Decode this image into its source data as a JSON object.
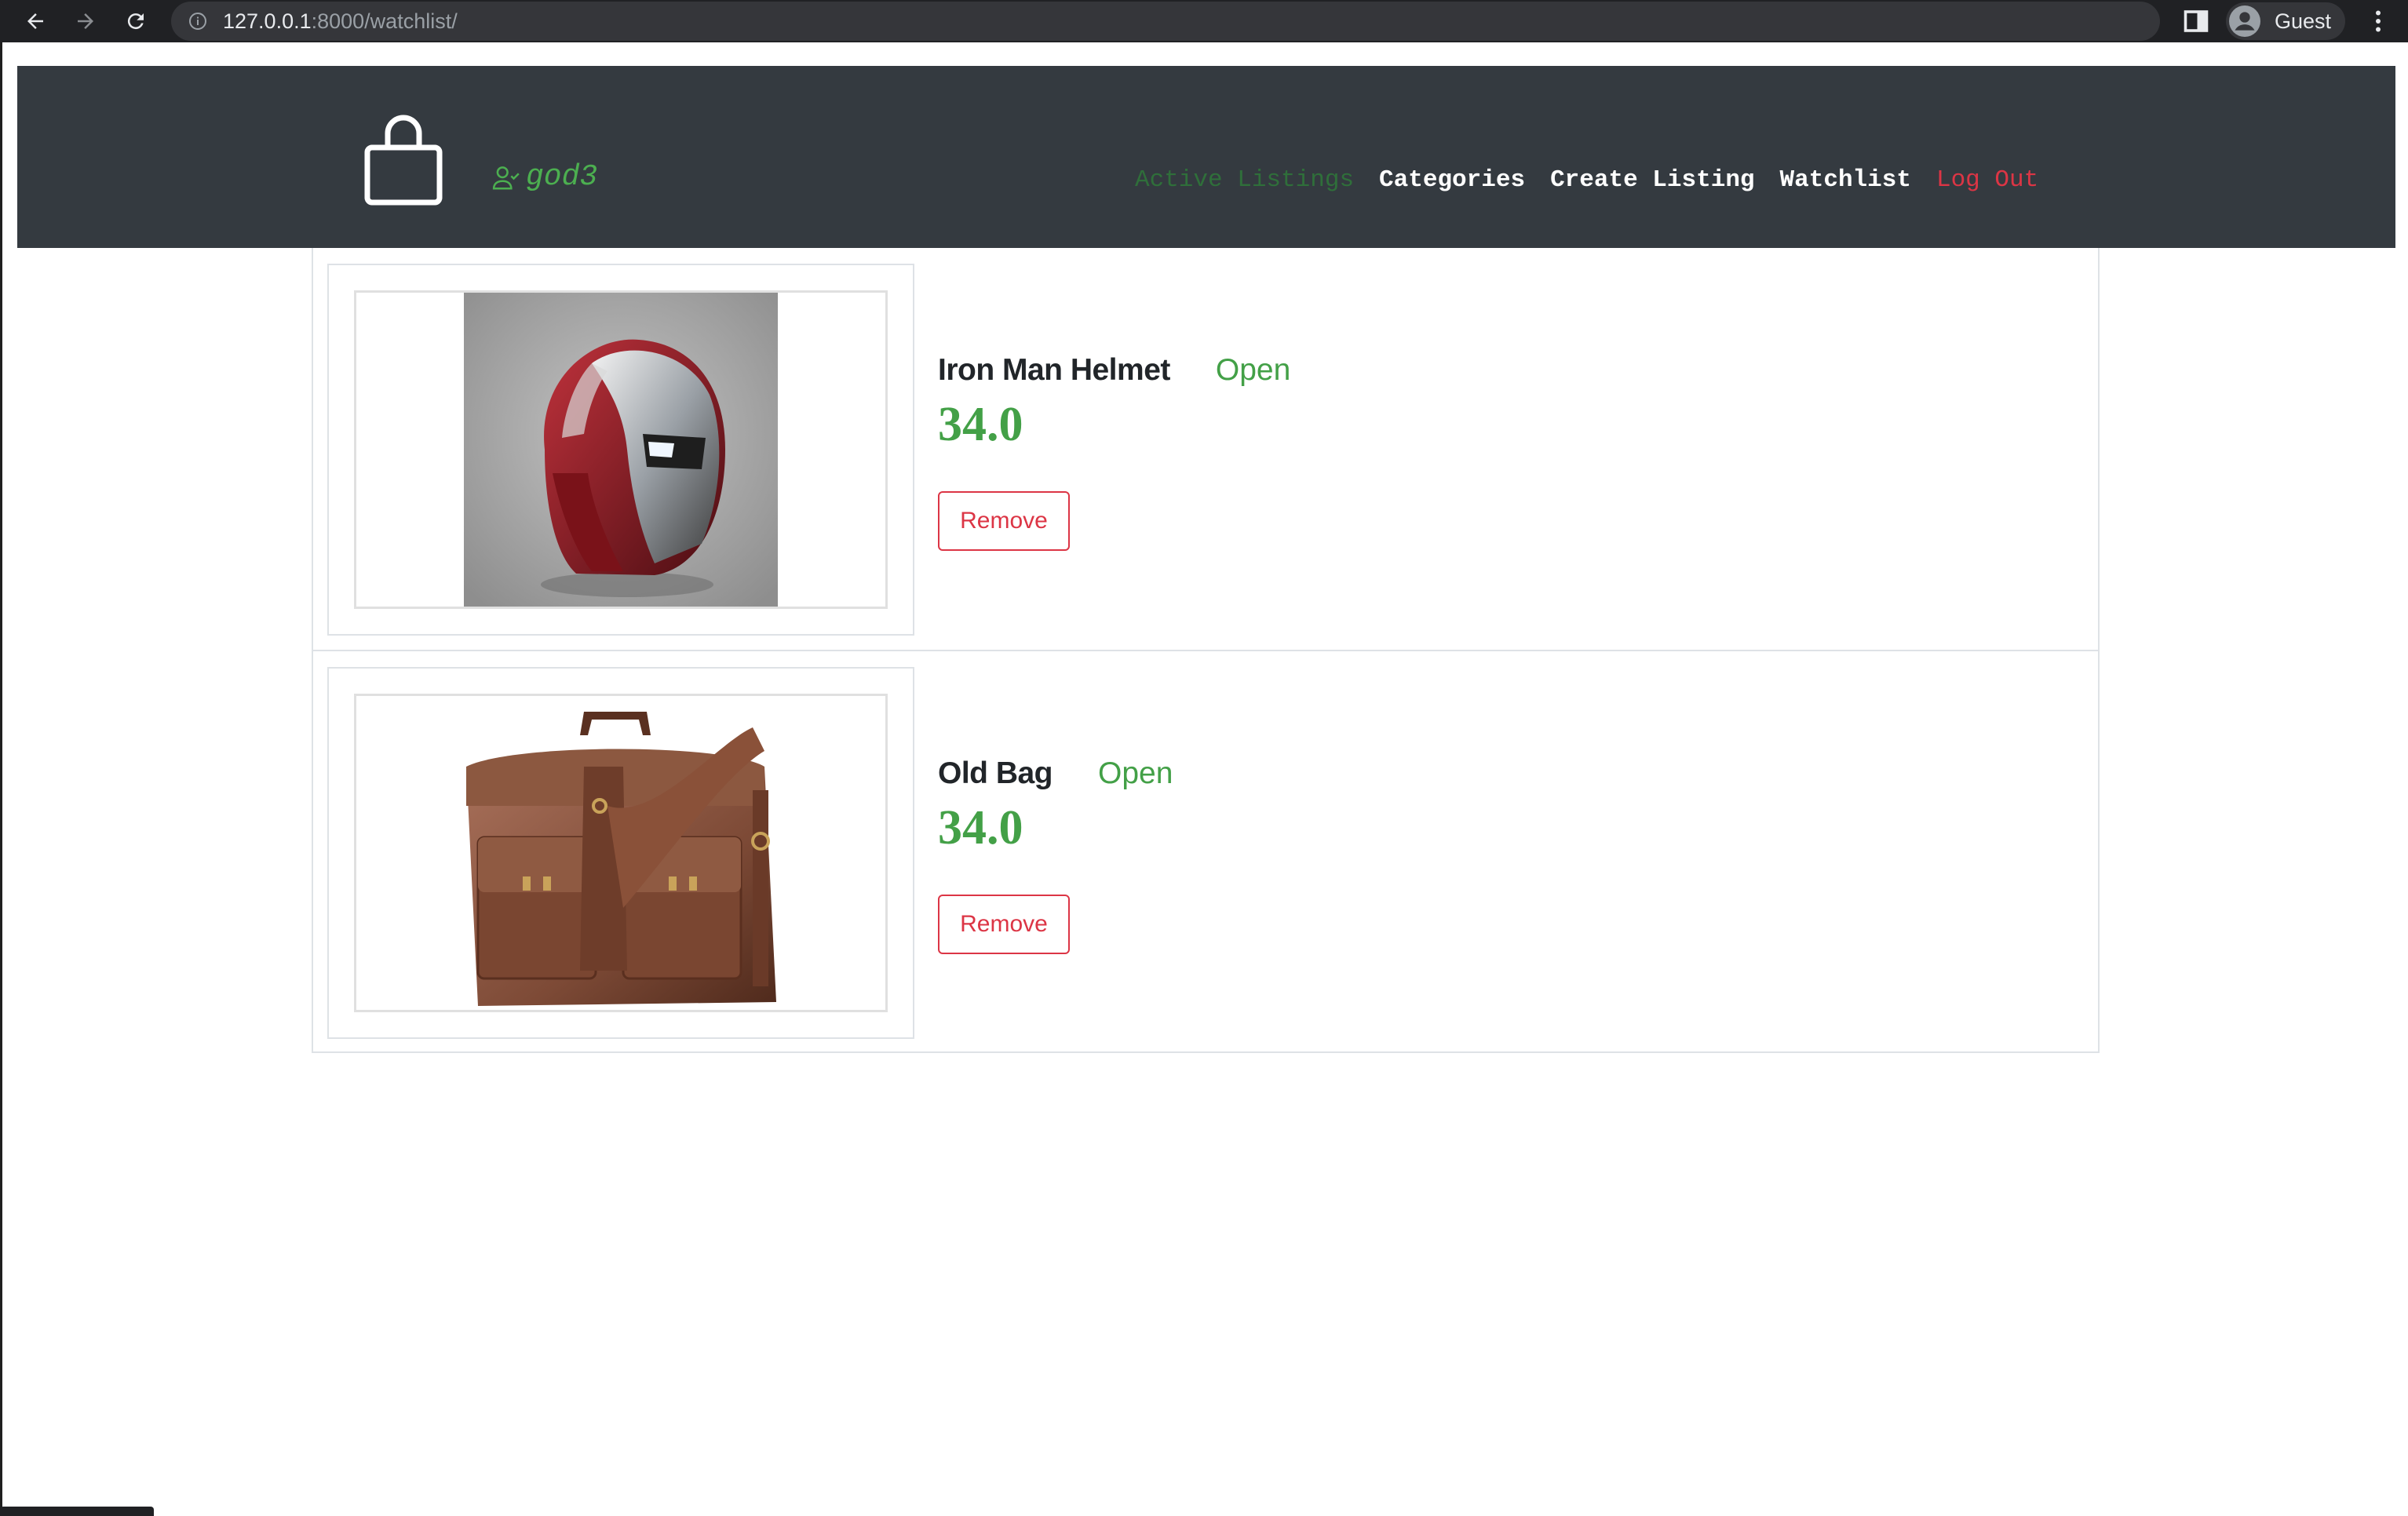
{
  "browser": {
    "url_host": "127.0.0.1",
    "url_rest": ":8000/watchlist/",
    "profile_name": "Guest"
  },
  "navbar": {
    "username": "god3",
    "links": {
      "active_listings": "Active Listings",
      "categories": "Categories",
      "create_listing": "Create Listing",
      "watchlist": "Watchlist",
      "log_out": "Log Out"
    }
  },
  "listings": [
    {
      "title": "Iron Man Helmet",
      "status": "Open",
      "price": "34.0",
      "remove_label": "Remove",
      "image": "iron-man-helmet-photo"
    },
    {
      "title": "Old Bag",
      "status": "Open",
      "price": "34.0",
      "remove_label": "Remove",
      "image": "leather-bag-photo"
    }
  ],
  "colors": {
    "navbar_bg": "#343a40",
    "accent_green": "#43a047",
    "danger_red": "#dc3545"
  }
}
